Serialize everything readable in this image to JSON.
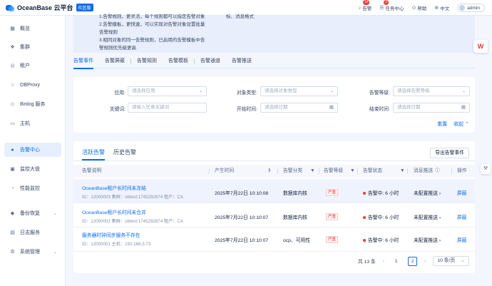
{
  "header": {
    "logo_text": "OceanBase 云平台",
    "edition": "社区版",
    "alarm_label": "告警",
    "alarm_count": "14",
    "task_label": "任务中心",
    "task_count": "2",
    "help_label": "帮助",
    "lang_label": "中文",
    "user": "admin"
  },
  "sidebar": {
    "items": [
      {
        "label": "概览",
        "icon": "grid-icon"
      },
      {
        "label": "集群",
        "icon": "cluster-icon"
      },
      {
        "label": "租户",
        "icon": "tenant-icon"
      },
      {
        "label": "OBProxy",
        "icon": "proxy-icon"
      },
      {
        "label": "Binlog 服务",
        "icon": "binlog-icon"
      },
      {
        "label": "主机",
        "icon": "host-icon"
      },
      {
        "label": "告警中心",
        "icon": "alarm-icon"
      },
      {
        "label": "监控大盘",
        "icon": "dashboard-icon"
      },
      {
        "label": "性能监控",
        "icon": "performance-icon"
      },
      {
        "label": "备份恢复",
        "icon": "backup-icon"
      },
      {
        "label": "日志服务",
        "icon": "log-icon"
      },
      {
        "label": "系统管理",
        "icon": "system-icon"
      }
    ],
    "active_index": 6
  },
  "notice": {
    "line0": "1.告警规则，更灵活，每个规则都可以指定告警对象",
    "line0b": "标、消息格式",
    "line1": "2.告警模板，更快速，可以实现对告警对象设置批量",
    "line2": "告警规则",
    "line3": "3.相同对象的同一告警规则，已启用的告警模板中告",
    "line4": "警规则优先级更高"
  },
  "tabs": [
    "告警事件",
    "告警屏蔽",
    "告警规则",
    "告警模板",
    "告警通道",
    "告警推送"
  ],
  "filters": {
    "app_label": "应用:",
    "app_placeholder": "请选择应用",
    "object_label": "对象类型:",
    "object_placeholder": "请选择对象类型",
    "level_label": "告警等级:",
    "level_placeholder": "请选择告警等级",
    "keyword_label": "关键词:",
    "keyword_placeholder": "请输入任意关键词",
    "start_label": "开始时间:",
    "start_placeholder": "请选择日期",
    "end_label": "结束时间:",
    "end_placeholder": "请选择日期",
    "reset": "重置",
    "collapse": "收起"
  },
  "table": {
    "tab_active": "活跃告警",
    "tab_history": "历史告警",
    "export": "导出告警事件",
    "columns": [
      "告警说明",
      "产生时间",
      "告警分类",
      "告警等级",
      "告警状态",
      "消息推送",
      "操作"
    ],
    "rows": [
      {
        "title": "OceanBase租户长时间未冻结",
        "sub": "ID：12000003  集群：obtest:1745292874  租户：CA",
        "time": "2025年7月22日 10:10:08",
        "category": "数据库内核",
        "level": "严重",
        "status": "告警中: 6 小时",
        "push": "未配置推送",
        "action": "屏蔽"
      },
      {
        "title": "OceanBase租户长时间未合并",
        "sub": "ID：12000002  集群：obtest:1745292874  租户：CA",
        "time": "2025年7月22日 10:10:07",
        "category": "数据库内核",
        "level": "严重",
        "status": "告警中: 6 小时",
        "push": "未配置推送",
        "action": "屏蔽"
      },
      {
        "title": "服务器时钟同步服务不存在",
        "sub": "ID：12000001  主机：192.168.3.73",
        "time": "2025年7月22日 10:10:07",
        "category": "ocp、可用性",
        "level": "严重",
        "status": "告警中: 6 小时",
        "push": "未配置推送",
        "action": "屏蔽"
      }
    ],
    "total": "共 13 条",
    "pages": [
      "1",
      "2"
    ],
    "current_page": "2",
    "page_size": "10 条/页"
  },
  "colors": {
    "accent": "#0b6cf0",
    "danger": "#f93939"
  }
}
